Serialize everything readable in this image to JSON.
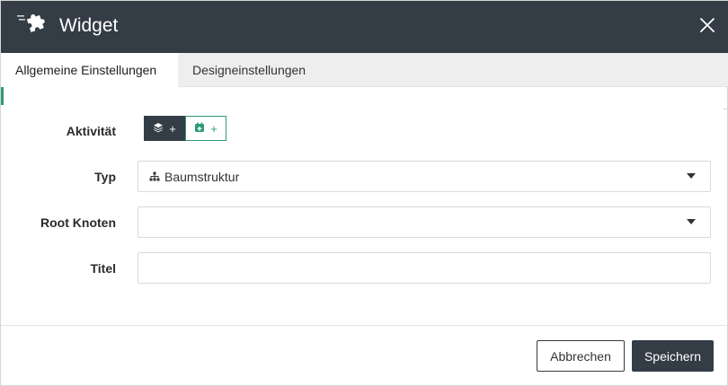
{
  "dialog": {
    "title": "Widget",
    "title_icon": "puzzle-icon",
    "close_icon": "close-icon"
  },
  "tabs": [
    {
      "label": "Allgemeine Einstellungen",
      "active": true
    },
    {
      "label": "Designeinstellungen",
      "active": false
    }
  ],
  "form": {
    "activity": {
      "label": "Aktivität",
      "buttons": [
        {
          "icon": "layers-icon",
          "text": "+"
        },
        {
          "icon": "calendar-icon",
          "text": "+"
        }
      ]
    },
    "type": {
      "label": "Typ",
      "value": "Baumstruktur",
      "icon": "sitemap-icon"
    },
    "root": {
      "label": "Root Knoten",
      "value": ""
    },
    "title": {
      "label": "Titel",
      "value": "",
      "placeholder": ""
    }
  },
  "footer": {
    "cancel": "Abbrechen",
    "save": "Speichern"
  },
  "colors": {
    "header": "#343d45",
    "accent": "#2f9c72",
    "tab_bar": "#eeeeee"
  }
}
